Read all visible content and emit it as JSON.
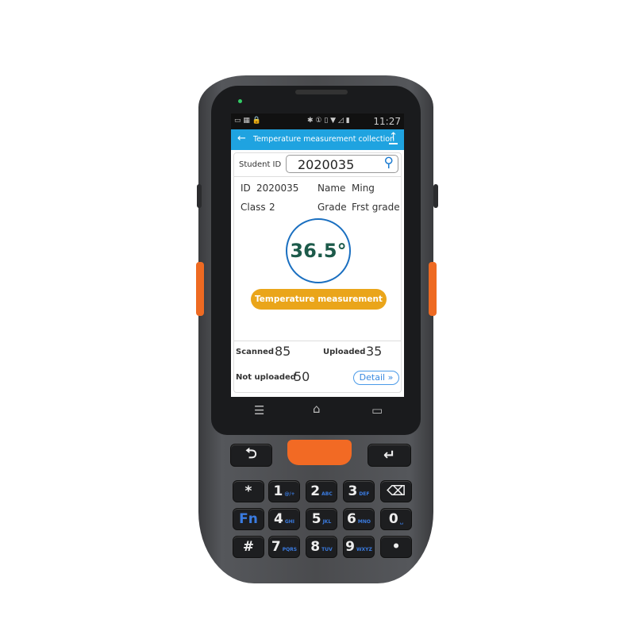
{
  "status_bar": {
    "time": "11:27",
    "icons": [
      "image-icon",
      "keyboard-icon",
      "lock-icon",
      "bluetooth-icon",
      "sim-1-icon",
      "vibrate-icon",
      "wifi-icon",
      "no-signal-icon",
      "battery-icon"
    ]
  },
  "app_bar": {
    "title": "Temperature measurement collection",
    "back_icon": "arrow-left-icon",
    "upload_icon": "upload-icon"
  },
  "search": {
    "label": "Student ID",
    "value": "2020035",
    "icon": "search-icon"
  },
  "student": {
    "id_label": "ID",
    "id": "2020035",
    "name_label": "Name",
    "name": "Ming",
    "class_label": "Class",
    "class": "2",
    "grade_label": "Grade",
    "grade": "Frst grade"
  },
  "temperature": {
    "value": "36.5°",
    "button": "Temperature measurement"
  },
  "stats": {
    "scanned_label": "Scanned",
    "scanned": "85",
    "uploaded_label": "Uploaded",
    "uploaded": "35",
    "not_uploaded_label": "Not uploaded",
    "not_uploaded": "50",
    "detail": "Detail »"
  },
  "keypad": {
    "rows": [
      [
        {
          "main": "*",
          "sub": ""
        },
        {
          "main": "1",
          "sub": "@/+"
        },
        {
          "main": "2",
          "sub": "ABC"
        },
        {
          "main": "3",
          "sub": "DEF"
        },
        {
          "main": "⌫",
          "sub": ""
        }
      ],
      [
        {
          "main": "Fn",
          "sub": ""
        },
        {
          "main": "4",
          "sub": "GHI"
        },
        {
          "main": "5",
          "sub": "JKL"
        },
        {
          "main": "6",
          "sub": "MNO"
        },
        {
          "main": "0",
          "sub": "␣"
        }
      ],
      [
        {
          "main": "#",
          "sub": ""
        },
        {
          "main": "7",
          "sub": "PQRS"
        },
        {
          "main": "8",
          "sub": "TUV"
        },
        {
          "main": "9",
          "sub": "WXYZ"
        },
        {
          "main": "•",
          "sub": ""
        }
      ]
    ],
    "back": "⮌",
    "enter": "↵"
  },
  "colors": {
    "accent": "#1fa3e0",
    "button": "#eaa51a",
    "temp_ring": "#1a6fc0",
    "temp_text": "#1c5a4a",
    "scan_key": "#f26a24"
  }
}
